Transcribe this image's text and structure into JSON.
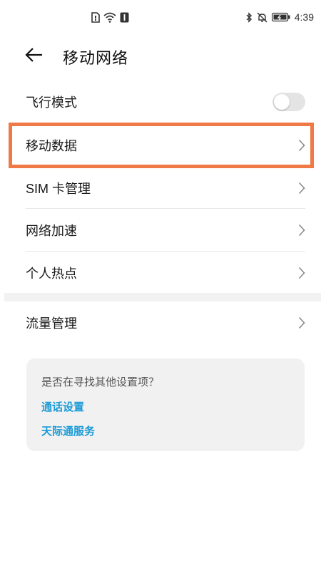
{
  "status_bar": {
    "left_icons": [
      "sim-icon",
      "wifi-icon",
      "nfc-icon"
    ],
    "right_icons": [
      "bluetooth-icon",
      "mute-icon",
      "battery-icon"
    ],
    "time": "4:39"
  },
  "header": {
    "back_icon": "arrow-left-icon",
    "title": "移动网络"
  },
  "settings": {
    "airplane_mode": {
      "label": "飞行模式",
      "enabled": false
    },
    "items": [
      {
        "label": "移动数据",
        "icon": "chevron-right-icon"
      },
      {
        "label": "SIM 卡管理",
        "icon": "chevron-right-icon"
      },
      {
        "label": "网络加速",
        "icon": "chevron-right-icon"
      },
      {
        "label": "个人热点",
        "icon": "chevron-right-icon"
      }
    ],
    "traffic": {
      "label": "流量管理",
      "icon": "chevron-right-icon"
    }
  },
  "suggestion": {
    "title": "是否在寻找其他设置项？",
    "links": [
      "通话设置",
      "天际通服务"
    ]
  },
  "colors": {
    "highlight": "#f07a45",
    "link": "#1a9ad6",
    "toggle_off": "#e4e4e4"
  }
}
